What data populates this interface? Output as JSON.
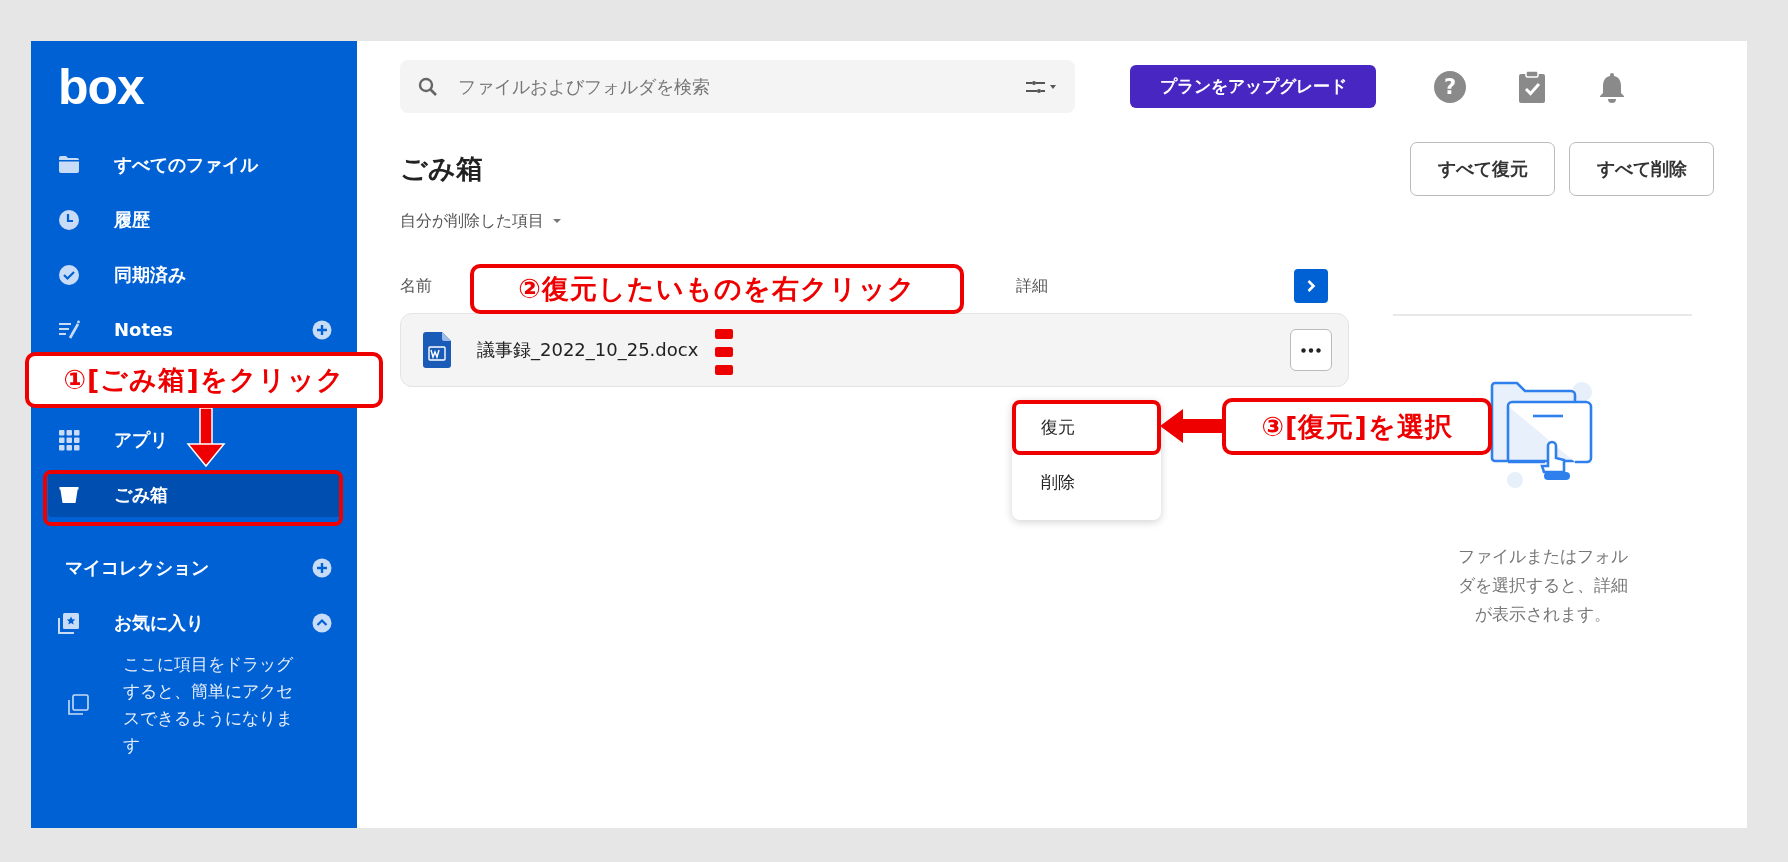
{
  "sidebar": {
    "logo": "box",
    "items": [
      {
        "label": "すべてのファイル",
        "selected": false,
        "add": false
      },
      {
        "label": "履歴",
        "selected": false,
        "add": false
      },
      {
        "label": "同期済み",
        "selected": false,
        "add": false
      },
      {
        "label": "Notes",
        "selected": false,
        "add": true
      },
      {
        "label": "アプリ",
        "selected": false,
        "add": false
      },
      {
        "label": "ごみ箱",
        "selected": true,
        "add": false
      }
    ],
    "collections": {
      "title": "マイコレクション"
    },
    "favorites": {
      "label": "お気に入り",
      "expanded": true,
      "hint": "ここに項目をドラッグすると、簡単にアクセスできるようになります"
    }
  },
  "search": {
    "placeholder": "ファイルおよびフォルダを検索"
  },
  "upgrade_button": "プランをアップグレード",
  "help_button": "?",
  "page": {
    "title": "ごみ箱",
    "buttons": [
      "すべて復元",
      "すべて削除"
    ],
    "filter": "自分が削除した項目"
  },
  "table": {
    "columns": [
      "名前",
      "詳細"
    ],
    "rows": [
      {
        "name": "議事録_2022_10_25.docx",
        "selected": false
      }
    ]
  },
  "context_menu": {
    "items": [
      {
        "label": "復元",
        "highlighted": true
      },
      {
        "label": "削除",
        "highlighted": false
      }
    ]
  },
  "details": {
    "empty_text": "ファイルまたはフォルダを選択すると、詳細が表示されます。"
  },
  "annotations": [
    {
      "text": "①[ごみ箱]をクリック"
    },
    {
      "text": "②復元したいものを右クリック"
    },
    {
      "text": "③[復元]を選択"
    }
  ]
}
